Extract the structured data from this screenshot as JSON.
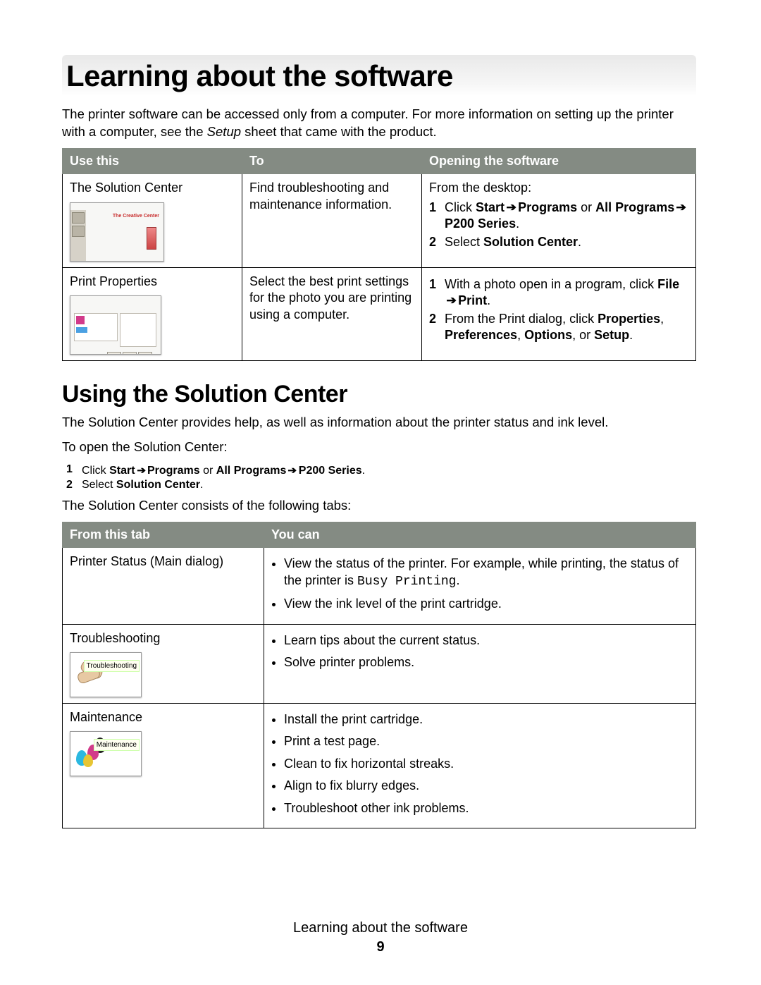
{
  "chapter_title": "Learning about the software",
  "intro_text_1": "The printer software can be accessed only from a computer. For more information on setting up the printer with a computer, see the ",
  "intro_setup_italic": "Setup",
  "intro_text_2": " sheet that came with the product.",
  "table1": {
    "headers": {
      "use": "Use this",
      "to": "To",
      "open": "Opening the software"
    },
    "rows": [
      {
        "use": "The Solution Center",
        "to": "Find troubleshooting and maintenance information.",
        "open_intro": "From the desktop:",
        "open_steps": [
          {
            "pre": "Click ",
            "b1": "Start",
            "mid1": " ",
            "arrow1": "➔",
            "mid2": " ",
            "b2": "Programs",
            "or": " or ",
            "b3": "All Programs",
            "arrow2": " ➔ ",
            "b4": "P200 Series",
            "post": "."
          },
          {
            "pre": "Select ",
            "b1": "Solution Center",
            "post": "."
          }
        ]
      },
      {
        "use": "Print Properties",
        "to": "Select the best print settings for the photo you are printing using a computer.",
        "open_steps": [
          {
            "pre": "With a photo open in a program, click ",
            "b1": "File",
            "arrow1": " ➔ ",
            "b2": "Print",
            "post": "."
          },
          {
            "pre": "From the Print dialog, click ",
            "b1": "Properties",
            "c1": ", ",
            "b2": "Preferences",
            "c2": ", ",
            "b3": "Options",
            "c3": ", or ",
            "b4": "Setup",
            "post": "."
          }
        ]
      }
    ]
  },
  "section2_title": "Using the Solution Center",
  "sc_intro": "The Solution Center provides help, as well as information about the printer status and ink level.",
  "sc_open": "To open the Solution Center:",
  "sc_steps": [
    {
      "pre": "Click ",
      "b1": "Start",
      "arrow1": " ➔ ",
      "b2": "Programs",
      "or": " or ",
      "b3": "All Programs",
      "arrow2": " ➔ ",
      "b4": "P200 Series",
      "post": "."
    },
    {
      "pre": "Select ",
      "b1": "Solution Center",
      "post": "."
    }
  ],
  "sc_consists": "The Solution Center consists of the following tabs:",
  "table2": {
    "headers": {
      "from": "From this tab",
      "you": "You can"
    },
    "rows": [
      {
        "from": "Printer Status (Main dialog)",
        "bullets_rich": [
          {
            "pre": "View the status of the printer. For example, while printing, the status of the printer is ",
            "mono": "Busy Printing",
            "post": "."
          }
        ],
        "bullets_plain": [
          "View the ink level of the print cartridge."
        ]
      },
      {
        "from": "Troubleshooting",
        "icon_label": "Troubleshooting",
        "bullets_plain": [
          "Learn tips about the current status.",
          "Solve printer problems."
        ]
      },
      {
        "from": "Maintenance",
        "icon_label": "Maintenance",
        "bullets_plain": [
          "Install the print cartridge.",
          "Print a test page.",
          "Clean to fix horizontal streaks.",
          "Align to fix blurry edges.",
          "Troubleshoot other ink problems."
        ]
      }
    ]
  },
  "footer_title": "Learning about the software",
  "page_number": "9"
}
